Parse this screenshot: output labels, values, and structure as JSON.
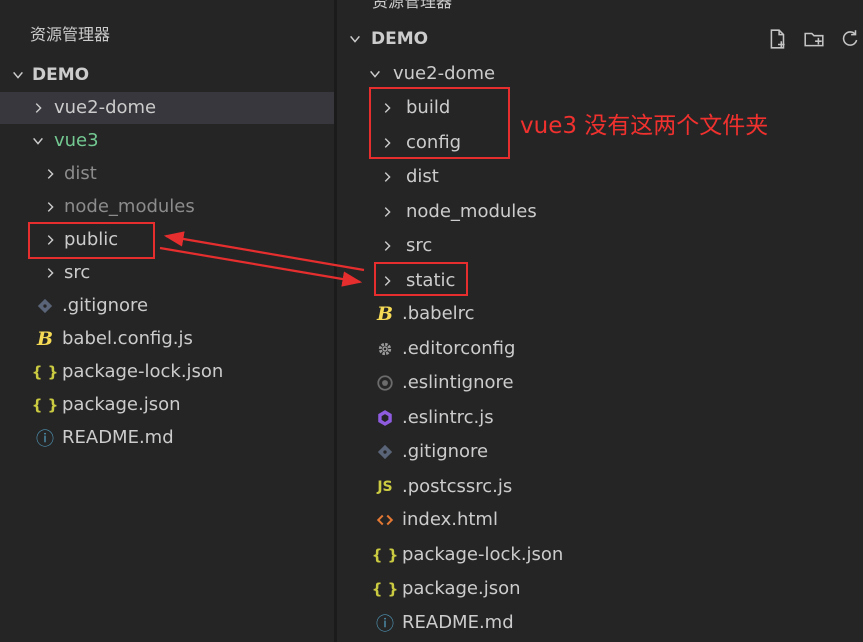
{
  "left_panel": {
    "title": "资源管理器",
    "root": "DEMO",
    "items": [
      {
        "label": "vue2-dome",
        "icon": "chevron-right-icon",
        "color": "#cccccc"
      },
      {
        "label": "vue3",
        "icon": "chevron-down-icon",
        "color": "#73c991"
      },
      {
        "label": "dist",
        "icon": "chevron-right-icon",
        "color": "#8c8c8c"
      },
      {
        "label": "node_modules",
        "icon": "chevron-right-icon",
        "color": "#8c8c8c"
      },
      {
        "label": "public",
        "icon": "chevron-right-icon",
        "color": "#cccccc"
      },
      {
        "label": "src",
        "icon": "chevron-right-icon",
        "color": "#cccccc"
      },
      {
        "label": ".gitignore",
        "icon": "git-icon",
        "color": "#cccccc"
      },
      {
        "label": "babel.config.js",
        "icon": "babel-icon",
        "color": "#cccccc"
      },
      {
        "label": "package-lock.json",
        "icon": "json-icon",
        "color": "#cccccc"
      },
      {
        "label": "package.json",
        "icon": "json-icon",
        "color": "#cccccc"
      },
      {
        "label": "README.md",
        "icon": "info-icon",
        "color": "#cccccc"
      }
    ]
  },
  "right_panel": {
    "title": "资源管理器",
    "root": "DEMO",
    "toolbar": [
      "new-file-icon",
      "new-folder-icon",
      "refresh-icon"
    ],
    "items": [
      {
        "label": "vue2-dome",
        "icon": "chevron-down-icon"
      },
      {
        "label": "build",
        "icon": "chevron-right-icon"
      },
      {
        "label": "config",
        "icon": "chevron-right-icon"
      },
      {
        "label": "dist",
        "icon": "chevron-right-icon"
      },
      {
        "label": "node_modules",
        "icon": "chevron-right-icon"
      },
      {
        "label": "src",
        "icon": "chevron-right-icon"
      },
      {
        "label": "static",
        "icon": "chevron-right-icon"
      },
      {
        "label": ".babelrc",
        "icon": "babel-icon"
      },
      {
        "label": ".editorconfig",
        "icon": "gear-icon"
      },
      {
        "label": ".eslintignore",
        "icon": "eslint-ignore-icon"
      },
      {
        "label": ".eslintrc.js",
        "icon": "eslint-icon"
      },
      {
        "label": ".gitignore",
        "icon": "git-icon"
      },
      {
        "label": ".postcssrc.js",
        "icon": "js-icon"
      },
      {
        "label": "index.html",
        "icon": "html-icon"
      },
      {
        "label": "package-lock.json",
        "icon": "json-icon"
      },
      {
        "label": "package.json",
        "icon": "json-icon"
      },
      {
        "label": "README.md",
        "icon": "info-icon"
      }
    ]
  },
  "annotation": {
    "note": "vue3 没有这两个文件夹",
    "color": "#e62e2e"
  },
  "icon_glyphs": {
    "json": "{ }",
    "js": "JS",
    "babel": "B",
    "info": "ⓘ"
  }
}
